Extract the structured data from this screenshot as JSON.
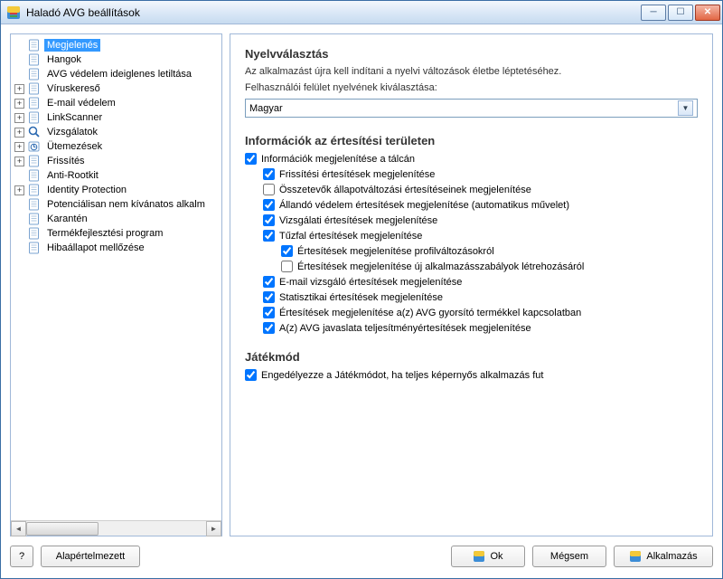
{
  "window": {
    "title": "Haladó AVG beállítások"
  },
  "tree": [
    {
      "label": "Megjelenés",
      "expander": "",
      "selected": true
    },
    {
      "label": "Hangok",
      "expander": ""
    },
    {
      "label": "AVG védelem ideiglenes letiltása",
      "expander": ""
    },
    {
      "label": "Víruskereső",
      "expander": "+"
    },
    {
      "label": "E-mail védelem",
      "expander": "+"
    },
    {
      "label": "LinkScanner",
      "expander": "+"
    },
    {
      "label": "Vizsgálatok",
      "expander": "+",
      "icon": "magnify"
    },
    {
      "label": "Ütemezések",
      "expander": "+",
      "icon": "sched"
    },
    {
      "label": "Frissítés",
      "expander": "+"
    },
    {
      "label": "Anti-Rootkit",
      "expander": ""
    },
    {
      "label": "Identity Protection",
      "expander": "+"
    },
    {
      "label": "Potenciálisan nem kívánatos alkalm",
      "expander": ""
    },
    {
      "label": "Karantén",
      "expander": ""
    },
    {
      "label": "Termékfejlesztési program",
      "expander": ""
    },
    {
      "label": "Hibaállapot mellőzése",
      "expander": ""
    }
  ],
  "lang": {
    "heading": "Nyelvválasztás",
    "info": "Az alkalmazást újra kell indítani a nyelvi változások életbe léptetéséhez.",
    "label": "Felhasználói felület nyelvének kiválasztása:",
    "value": "Magyar"
  },
  "notif": {
    "heading": "Információk az értesítési területen",
    "items": [
      {
        "label": "Információk megjelenítése a tálcán",
        "checked": true,
        "indent": 0
      },
      {
        "label": "Frissítési értesítések megjelenítése",
        "checked": true,
        "indent": 1
      },
      {
        "label": "Összetevők állapotváltozási értesítéseinek megjelenítése",
        "checked": false,
        "indent": 1
      },
      {
        "label": "Állandó védelem értesítések megjelenítése (automatikus művelet)",
        "checked": true,
        "indent": 1
      },
      {
        "label": "Vizsgálati értesítések megjelenítése",
        "checked": true,
        "indent": 1
      },
      {
        "label": "Tűzfal értesítések megjelenítése",
        "checked": true,
        "indent": 1
      },
      {
        "label": "Értesítések megjelenítése profilváltozásokról",
        "checked": true,
        "indent": 2
      },
      {
        "label": "Értesítések megjelenítése új alkalmazásszabályok létrehozásáról",
        "checked": false,
        "indent": 2
      },
      {
        "label": "E-mail vizsgáló értesítések megjelenítése",
        "checked": true,
        "indent": 1
      },
      {
        "label": "Statisztikai értesítések megjelenítése",
        "checked": true,
        "indent": 1
      },
      {
        "label": "Értesítések megjelenítése a(z) AVG gyorsító termékkel kapcsolatban",
        "checked": true,
        "indent": 1
      },
      {
        "label": "A(z) AVG javaslata teljesítményértesítések megjelenítése",
        "checked": true,
        "indent": 1
      }
    ]
  },
  "game": {
    "heading": "Játékmód",
    "label": "Engedélyezze a Játékmódot, ha teljes képernyős alkalmazás fut",
    "checked": true
  },
  "buttons": {
    "help": "?",
    "default": "Alapértelmezett",
    "ok": "Ok",
    "cancel": "Mégsem",
    "apply": "Alkalmazás"
  }
}
